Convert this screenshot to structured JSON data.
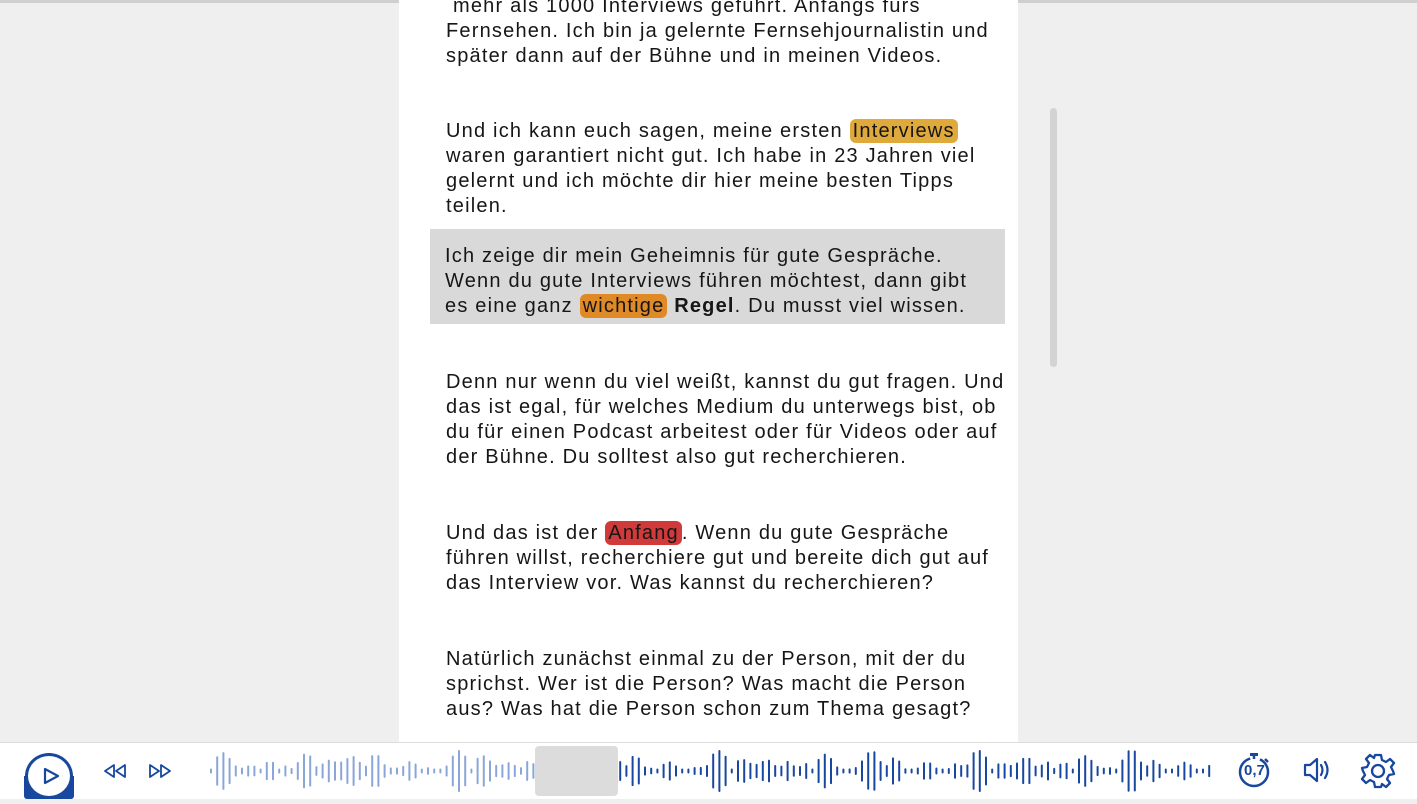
{
  "transcript": {
    "p0": "mehr als 1000 Interviews geführt. Anfangs fürs Fernsehen. Ich bin ja gelernte Fernsehjournalistin und später dann auf der Bühne und in meinen Videos.",
    "p1": {
      "before": "Und ich kann euch sagen, meine ersten ",
      "highlight": "Interviews",
      "after": " waren garantiert nicht gut. Ich habe in 23 Jahren viel gelernt und ich möchte dir hier meine besten Tipps teilen."
    },
    "p2": {
      "before": "Ich zeige dir mein Geheimnis für gute Gespräche. Wenn du gute Interviews führen möchtest, dann gibt es eine ganz ",
      "highlight": "wichtige",
      "bold": "Regel",
      "after": ". Du musst viel wissen."
    },
    "p3": "Denn nur wenn du viel weißt, kannst du gut fragen. Und das ist egal, für welches Medium du unterwegs bist, ob du für einen Podcast arbeitest oder für Videos oder auf der Bühne. Du solltest also gut recherchieren.",
    "p4": {
      "before": "Und das ist der ",
      "highlight": "Anfang",
      "after": ". Wenn du gute Gespräche führen willst, recherchiere gut und bereite dich gut auf das Interview vor. Was kannst du recherchieren?"
    },
    "p5": "Natürlich zunächst einmal zu der Person, mit der du sprichst. Wer ist die Person? Was macht die Person aus? Was hat die Person schon zum Thema gesagt?"
  },
  "player": {
    "speed": "0,7",
    "progress_fraction": 0.35,
    "icons": {
      "play": "play-icon",
      "rewind": "rewind-icon",
      "forward": "fast-forward-icon",
      "speed": "stopwatch-icon",
      "volume": "volume-icon",
      "settings": "gear-icon"
    }
  },
  "colors": {
    "accent": "#17479e",
    "wave_played": "#17479e",
    "wave_unplayed": "#8aa6d8",
    "highlight_gold": "#e0a93c",
    "highlight_orange": "#df8a26",
    "highlight_red": "#d13a3a",
    "active_paragraph": "#d9d9d9"
  }
}
